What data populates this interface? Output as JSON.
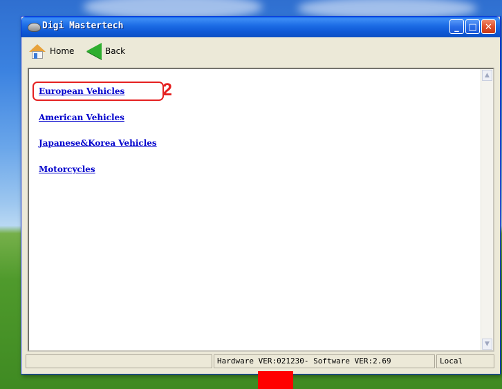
{
  "window": {
    "title": "Digi Mastertech",
    "controls": {
      "minimize": "_",
      "maximize": "□",
      "close": "✕"
    }
  },
  "toolbar": {
    "home_label": "Home",
    "back_label": "Back"
  },
  "links": [
    {
      "label": "European Vehicles",
      "highlighted": true
    },
    {
      "label": "American Vehicles"
    },
    {
      "label": "Japanese&Korea Vehicles"
    },
    {
      "label": "Motorcycles"
    }
  ],
  "annotation": {
    "step_number": "2",
    "color": "#e52020"
  },
  "statusbar": {
    "left": "",
    "versions": "Hardware VER:021230-  Software VER:2.69",
    "mode": "Local"
  },
  "scrollbar": {
    "up": "▲",
    "down": "▼"
  },
  "colors": {
    "link": "#0000cc",
    "title_bar": "#0b4fc4",
    "marker": "#ff0000"
  }
}
